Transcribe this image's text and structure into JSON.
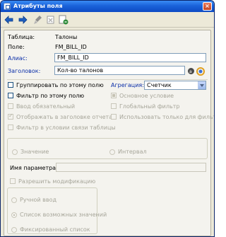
{
  "window": {
    "title": "Атрибуты поля",
    "close_glyph": "×"
  },
  "toolbar": {
    "buttons": [
      "arrow-left-icon",
      "arrow-right-icon",
      "brush-icon",
      "delete-icon",
      "clear-icon"
    ]
  },
  "form": {
    "table_label": "Таблица:",
    "table_value": "Талоны",
    "field_label": "Поле:",
    "field_value": "FM_BILL_ID",
    "alias_label": "Алиас:",
    "alias_value": "FM_BILL_ID",
    "header_label": "Заголовок:",
    "header_value": "Кол-во талонов"
  },
  "options": {
    "group_by": "Группировать по этому полю",
    "aggregation_label": "Агрегация:",
    "aggregation_value": "Счетчик",
    "filter_field": "Фильтр по этому полю",
    "main_condition": "Основное условие",
    "required_input": "Ввод обязательный",
    "global_filter": "Глобальный фильтр",
    "show_in_header": "Отображать в заголовке отчета",
    "filter_only": "Использовать только для фильтра",
    "filter_in_link": "Фильтр в условии связи таблицы"
  },
  "value_group": {
    "value_radio": "Значение",
    "interval_radio": "Интервал"
  },
  "param": {
    "name_label": "Имя параметра:",
    "name_value": ""
  },
  "modification": {
    "allow_mod": "Разрешить модификацию",
    "manual_input": "Ручной ввод",
    "possible_values": "Список возможных значений",
    "fixed_list": "Фиксированный список"
  },
  "colors": {
    "title_bar": "#1a62d9",
    "label_blue": "#0a2ea8",
    "disabled_text": "#a7a69a",
    "panel_bg": "#ece9d8"
  }
}
